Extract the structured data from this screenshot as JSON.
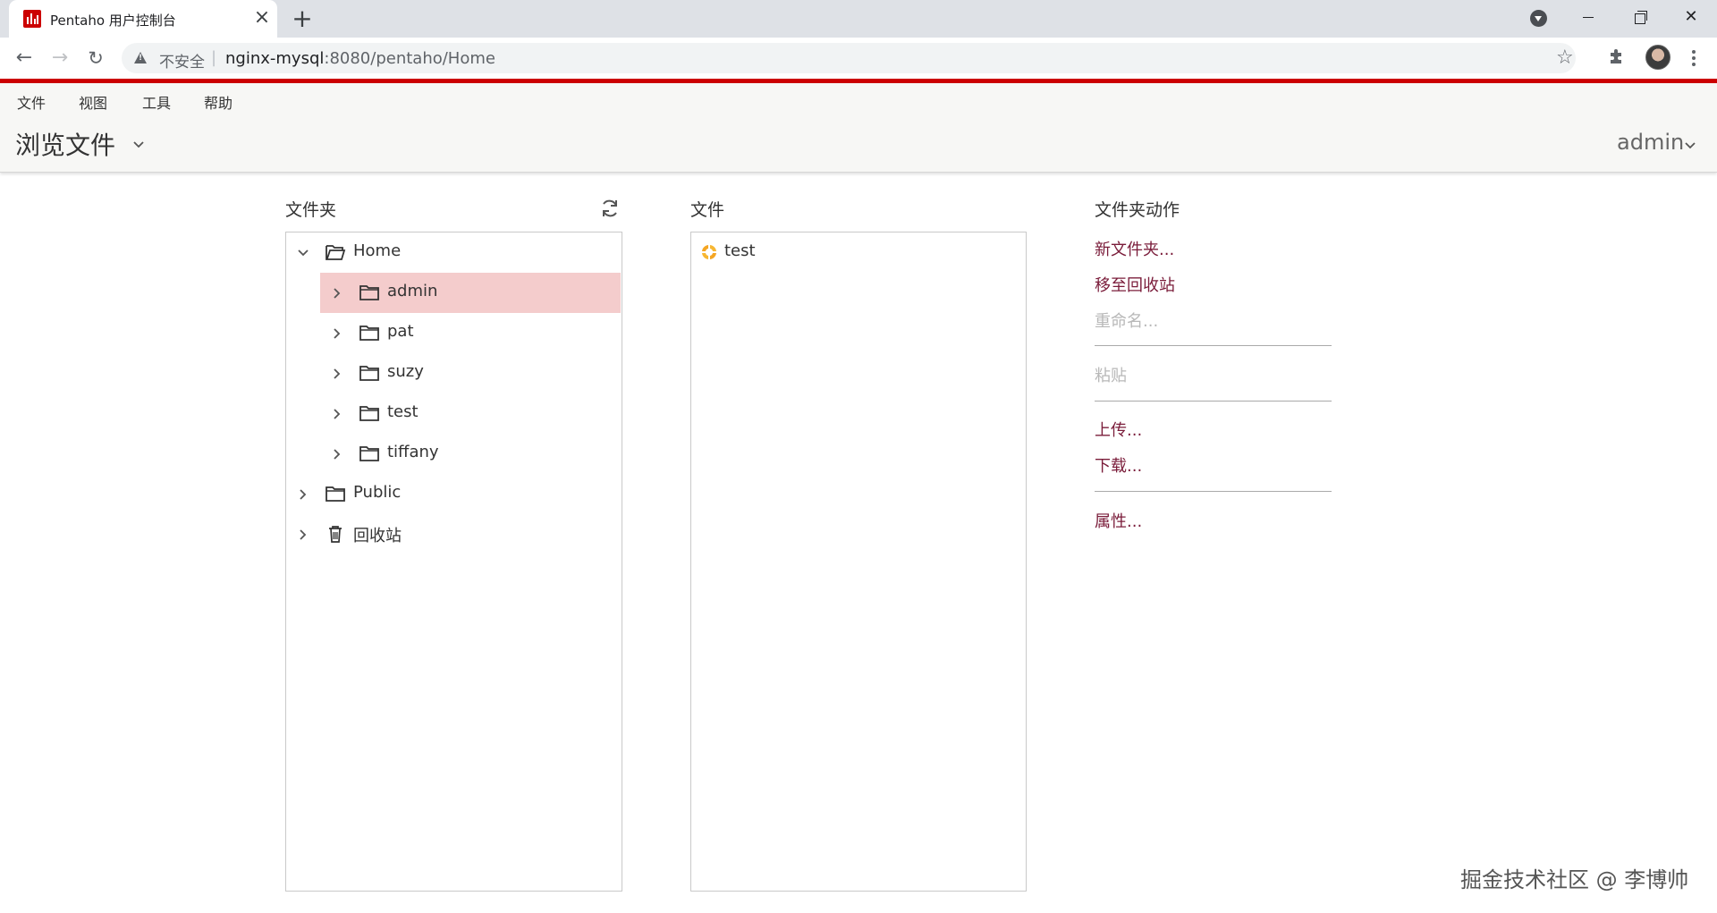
{
  "browser": {
    "tab_title": "Pentaho 用户控制台",
    "tab_close": "×",
    "new_tab": "+",
    "security_label": "不安全",
    "url_host": "nginx-mysql",
    "url_rest": ":8080/pentaho/Home"
  },
  "menubar": {
    "items": [
      "文件",
      "视图",
      "工具",
      "帮助"
    ]
  },
  "header": {
    "title": "浏览文件",
    "user": "admin"
  },
  "folders_panel": {
    "title": "文件夹",
    "tree": [
      {
        "label": "Home",
        "expanded": true,
        "icon": "folder-open-icon",
        "level": 0
      },
      {
        "label": "admin",
        "expanded": false,
        "icon": "folder-icon",
        "level": 1,
        "selected": true
      },
      {
        "label": "pat",
        "expanded": false,
        "icon": "folder-icon",
        "level": 1
      },
      {
        "label": "suzy",
        "expanded": false,
        "icon": "folder-icon",
        "level": 1
      },
      {
        "label": "test",
        "expanded": false,
        "icon": "folder-icon",
        "level": 1
      },
      {
        "label": "tiffany",
        "expanded": false,
        "icon": "folder-icon",
        "level": 1
      },
      {
        "label": "Public",
        "expanded": false,
        "icon": "folder-icon",
        "level": 0
      },
      {
        "label": "回收站",
        "expanded": false,
        "icon": "trash-icon",
        "level": 0
      }
    ]
  },
  "files_panel": {
    "title": "文件",
    "files": [
      {
        "label": "test",
        "icon": "kettle-transformation-icon"
      }
    ]
  },
  "actions_panel": {
    "title": "文件夹动作",
    "actions": [
      {
        "label": "新文件夹...",
        "enabled": true
      },
      {
        "label": "移至回收站",
        "enabled": true
      },
      {
        "label": "重命名...",
        "enabled": false
      },
      {
        "label": "粘贴",
        "enabled": false
      },
      {
        "label": "上传...",
        "enabled": true
      },
      {
        "label": "下载...",
        "enabled": true
      },
      {
        "label": "属性...",
        "enabled": true
      }
    ]
  },
  "watermark": "掘金技术社区 @ 李博帅",
  "colors": {
    "brand_red": "#cc0000",
    "selection": "#f4cccc",
    "action_link": "#7a1c3a",
    "action_disabled": "#b8b8b8"
  }
}
